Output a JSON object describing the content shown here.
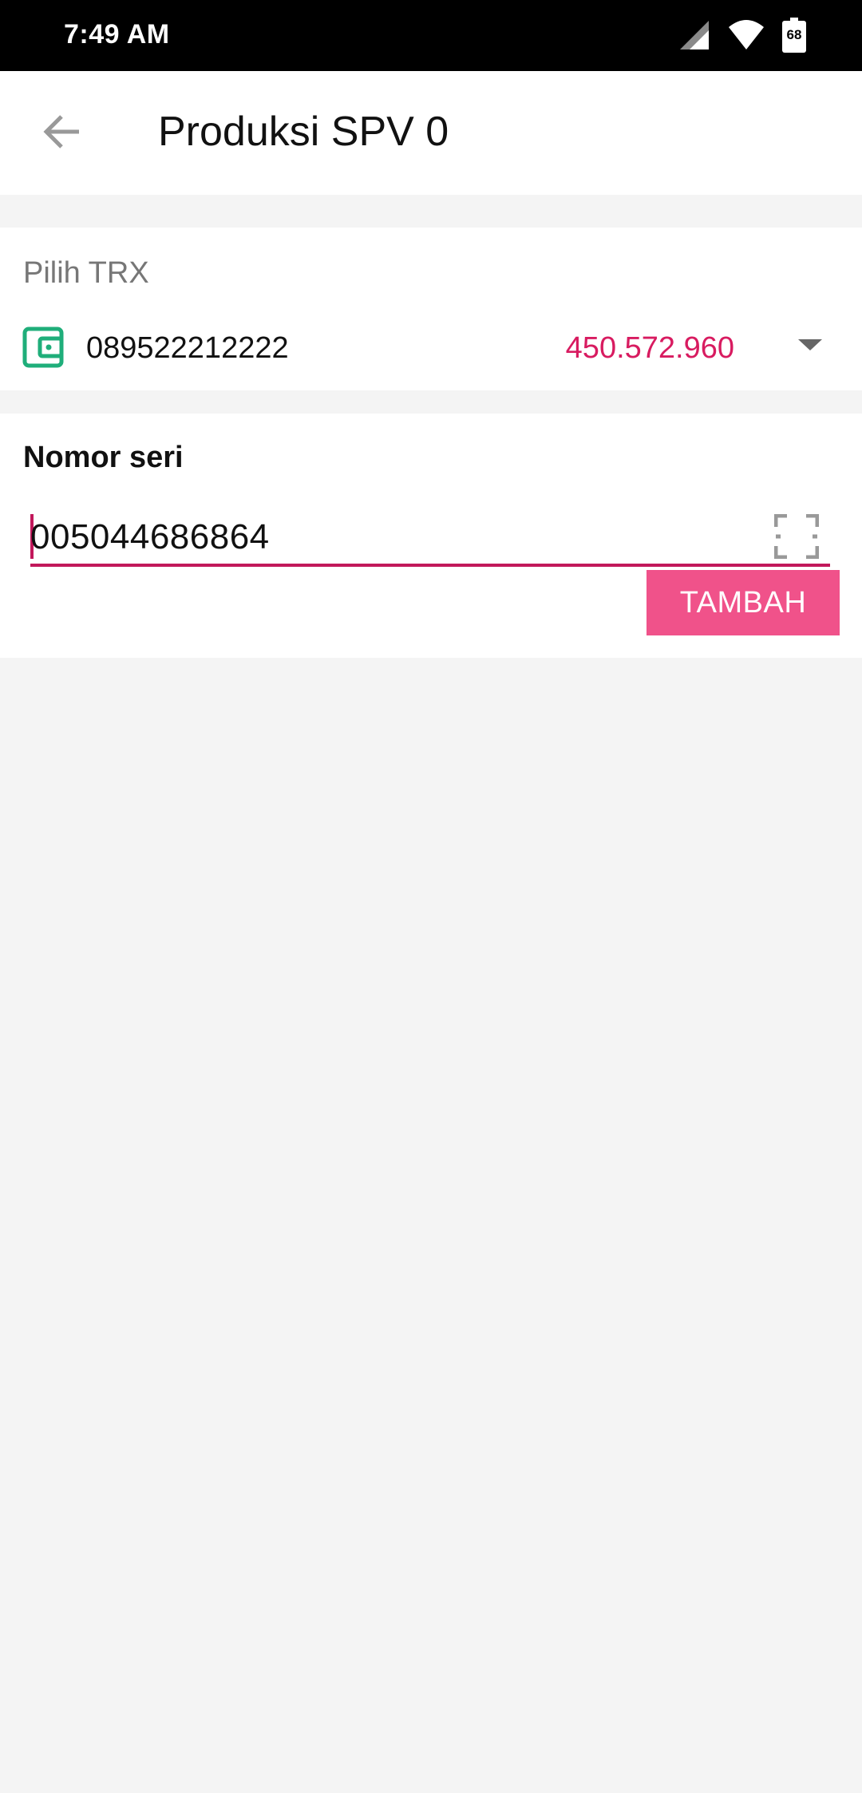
{
  "status_bar": {
    "time": "7:49 AM",
    "battery_level": "68",
    "icons": [
      "signal-icon",
      "wifi-icon",
      "battery-icon"
    ]
  },
  "app_bar": {
    "title": "Produksi SPV 0",
    "back_icon": "arrow-back-icon"
  },
  "trx": {
    "label": "Pilih TRX",
    "number": "089522212222",
    "balance": "450.572.960",
    "icon": "wallet-icon"
  },
  "serial": {
    "label": "Nomor seri",
    "value": "005044686864",
    "scan_icon": "scan-icon",
    "add_button_label": "TAMBAH"
  },
  "colors": {
    "accent": "#d81b60",
    "button": "#f0528a",
    "wallet_icon": "#1fae7a",
    "background": "#f4f4f4"
  }
}
